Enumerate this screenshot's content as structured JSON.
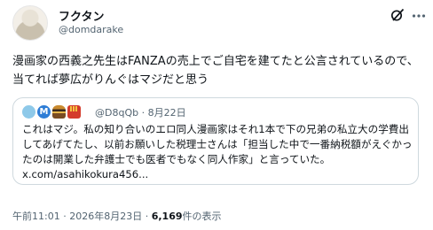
{
  "author": {
    "name": "フクタン",
    "handle": "@domdarake"
  },
  "post": {
    "text": "漫画家の西義之先生はFANZAの売上でご自宅を建てたと公言されているので、当てれば夢広がりんぐはマジだと思う"
  },
  "quote": {
    "avatar_badge": "M",
    "handle": "@D8qQb",
    "separator": "·",
    "date": "8月22日",
    "text": "これはマジ。私の知り合いのエロ同人漫画家はそれ1本で下の兄弟の私立大の学費出してあげてたし、以前お願いした税理士さんは「担当した中で一番納税額がえぐかったのは開業した弁護士でも医者でもなく同人作家」と言っていた。x.com/asahikokura456..."
  },
  "footer": {
    "time": "午前11:01",
    "dot1": "·",
    "date": "2026年8月23日",
    "dot2": "·",
    "views_count": "6,169",
    "views_label": "件の表示"
  },
  "icons": {
    "grok": "grok-icon",
    "more": "more-icon"
  }
}
